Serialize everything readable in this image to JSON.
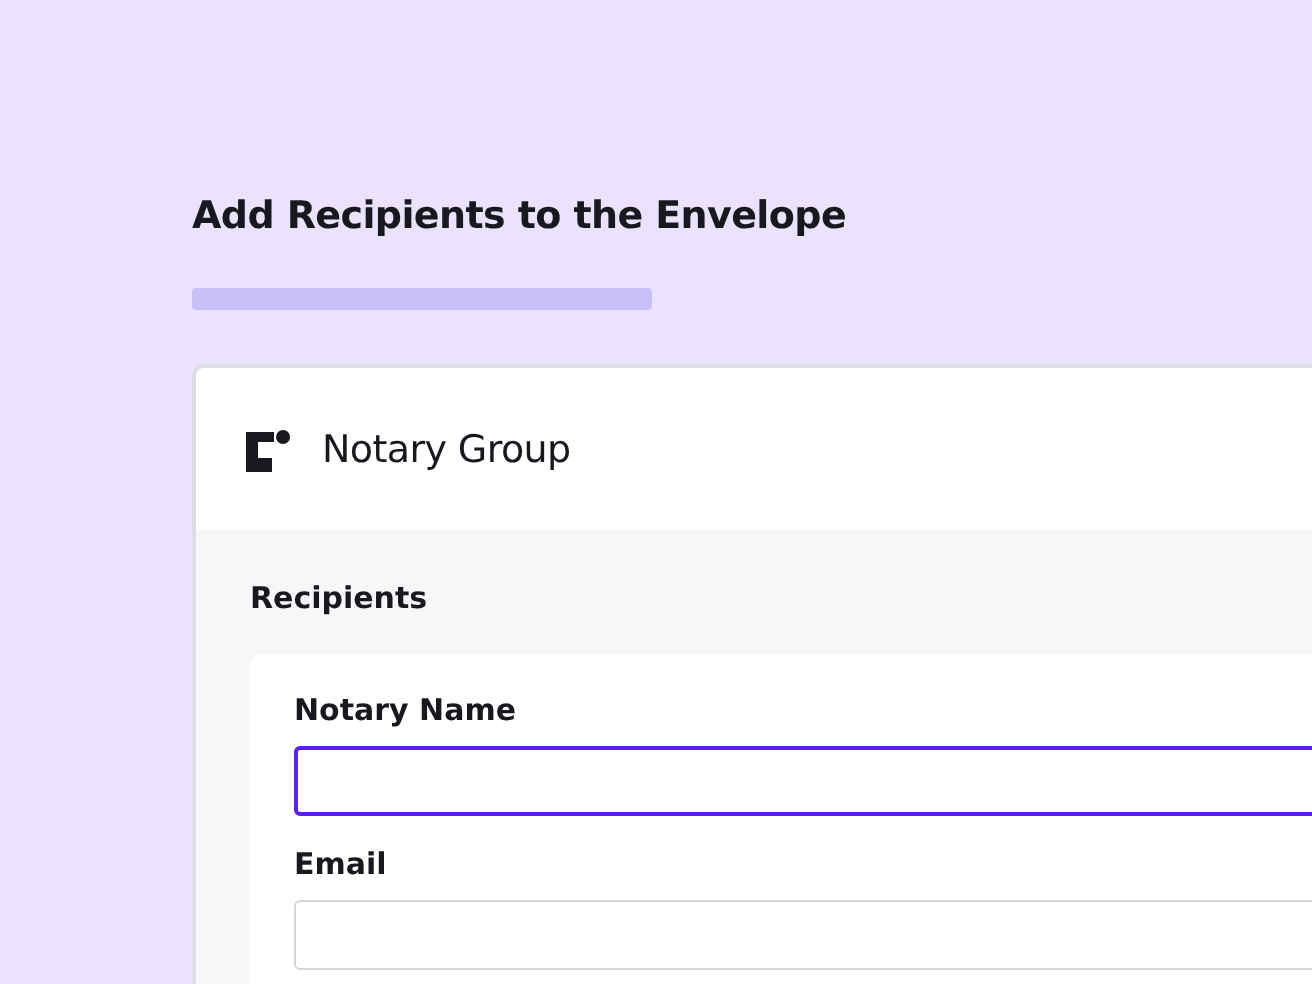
{
  "page": {
    "title": "Add Recipients to the Envelope"
  },
  "card": {
    "group_name": "Notary Group",
    "section_title": "Recipients",
    "fields": [
      {
        "label": "Notary Name",
        "focused": true
      },
      {
        "label": "Email",
        "focused": false
      }
    ]
  }
}
